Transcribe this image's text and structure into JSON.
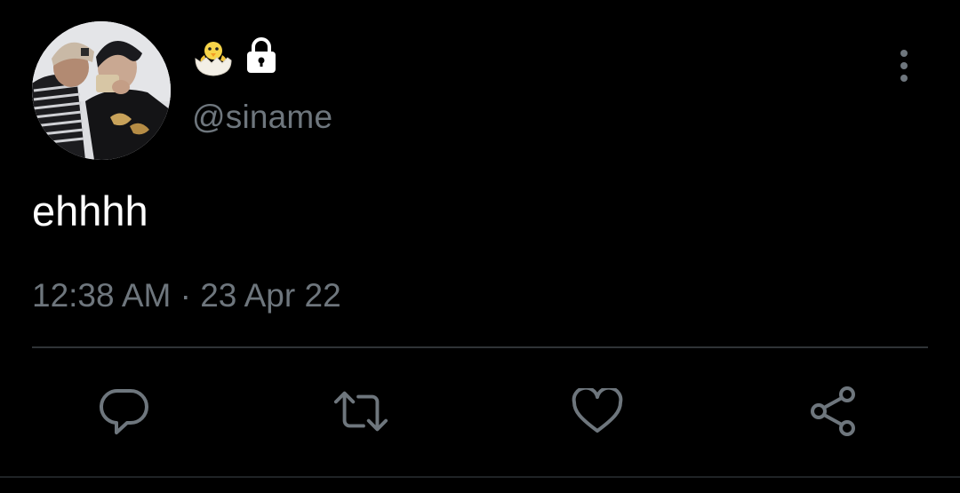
{
  "tweet": {
    "display_name_icons": [
      "hatching-chick-icon",
      "lock-icon"
    ],
    "handle": "@siname",
    "text": "ehhhh",
    "time": "12:38 AM",
    "separator": " · ",
    "date": "23 Apr 22"
  },
  "actions": [
    "reply-icon",
    "retweet-icon",
    "like-icon",
    "share-icon"
  ],
  "colors": {
    "background": "#000000",
    "text": "#ffffff",
    "secondary_text": "#6e767d",
    "divider": "#2f3336",
    "icon": "#6e767d"
  }
}
